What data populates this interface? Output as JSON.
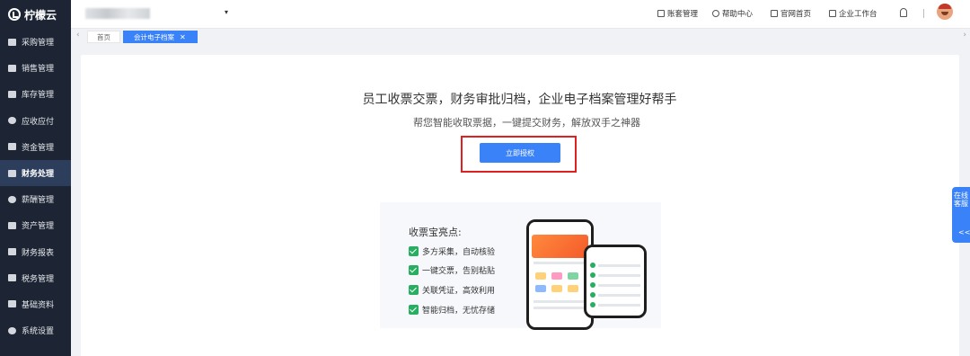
{
  "app": {
    "logo_text": "柠檬云"
  },
  "sidebar": {
    "items": [
      {
        "label": "采购管理"
      },
      {
        "label": "销售管理"
      },
      {
        "label": "库存管理"
      },
      {
        "label": "应收应付"
      },
      {
        "label": "资金管理"
      },
      {
        "label": "财务处理"
      },
      {
        "label": "薪酬管理"
      },
      {
        "label": "资产管理"
      },
      {
        "label": "财务报表"
      },
      {
        "label": "税务管理"
      },
      {
        "label": "基础资料"
      },
      {
        "label": "系统设置"
      }
    ]
  },
  "topbar": {
    "tenant_name": "",
    "links": {
      "account": "账套管理",
      "help": "帮助中心",
      "website": "官网首页",
      "workbench": "企业工作台"
    }
  },
  "tabs": {
    "home": "首页",
    "active": "会计电子档案"
  },
  "main": {
    "headline": "员工收票交票，财务审批归档，企业电子档案管理好帮手",
    "subline": "帮您智能收取票据，一键提交财务，解放双手之神器",
    "auth_button": "立即授权",
    "features_title": "收票宝亮点:",
    "features": [
      "多方采集，自动核验",
      "一键交票，告别粘贴",
      "关联凭证，高效利用",
      "智能归档，无忧存储"
    ]
  },
  "float": {
    "service_label": "在线客服",
    "collapse": "<<"
  },
  "colors": {
    "primary": "#3a82f7",
    "sidebar_bg": "#1d2535",
    "highlight_box": "#e02020",
    "check": "#27ae60"
  }
}
